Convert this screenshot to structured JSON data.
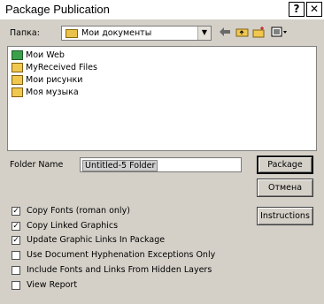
{
  "window": {
    "title": "Package Publication",
    "help_label": "?",
    "close_label": "✕"
  },
  "location": {
    "label": "Папка:",
    "value": "Мои документы",
    "dropdown_arrow": "▼"
  },
  "toolbar": {
    "icons": [
      "back-icon",
      "up-folder-icon",
      "new-folder-icon",
      "view-menu-icon"
    ]
  },
  "files": [
    {
      "name": "Мои Web",
      "icon": "web-folder-icon"
    },
    {
      "name": "MyReceived Files",
      "icon": "folder-icon"
    },
    {
      "name": "Мои рисунки",
      "icon": "folder-icon"
    },
    {
      "name": "Моя музыка",
      "icon": "folder-icon"
    }
  ],
  "folder_name": {
    "label": "Folder Name",
    "value": "Untitled-5 Folder"
  },
  "buttons": {
    "package": "Package",
    "cancel": "Отмена",
    "instructions": "Instructions"
  },
  "options": [
    {
      "label": "Copy Fonts (roman only)",
      "checked": true
    },
    {
      "label": "Copy Linked Graphics",
      "checked": true
    },
    {
      "label": "Update Graphic Links In Package",
      "checked": true
    },
    {
      "label": "Use Document Hyphenation Exceptions Only",
      "checked": false
    },
    {
      "label": "Include Fonts and Links From Hidden Layers",
      "checked": false
    },
    {
      "label": "View Report",
      "checked": false
    }
  ],
  "check_mark": "✓"
}
